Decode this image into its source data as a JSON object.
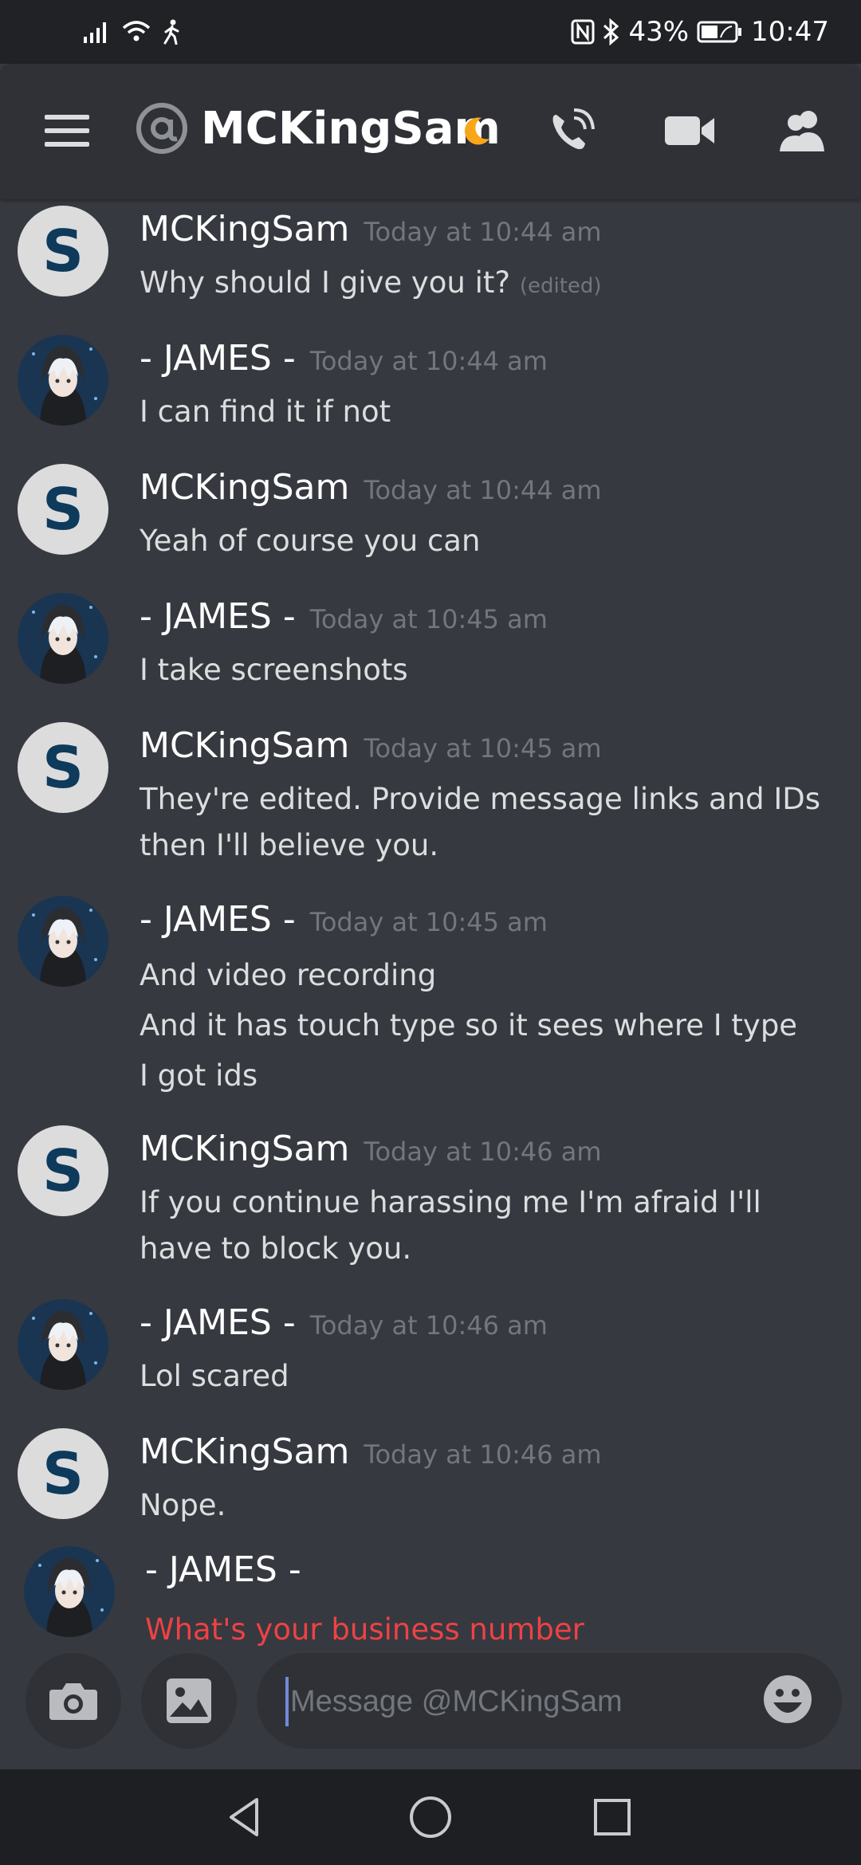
{
  "status_bar": {
    "battery_percent": "43%",
    "time": "10:47",
    "icons": [
      "signal-icon",
      "wifi-icon",
      "walking-icon",
      "nfc-icon",
      "bluetooth-icon",
      "battery-icon"
    ]
  },
  "header": {
    "title": "MCKingSam",
    "buttons": [
      "menu-icon",
      "call-icon",
      "video-icon",
      "members-icon"
    ]
  },
  "messages": [
    {
      "author": "MCKingSam",
      "avatar": "S",
      "time": "Today at 10:44 am",
      "lines": [
        "Why should I give you it?"
      ],
      "edited": "(edited)"
    },
    {
      "author": "- JAMES -",
      "avatar": "image",
      "time": "Today at 10:44 am",
      "lines": [
        "I can find it if not"
      ]
    },
    {
      "author": "MCKingSam",
      "avatar": "S",
      "time": "Today at 10:44 am",
      "lines": [
        "Yeah of course you can"
      ]
    },
    {
      "author": "- JAMES -",
      "avatar": "image",
      "time": "Today at 10:45 am",
      "lines": [
        "I take screenshots"
      ]
    },
    {
      "author": "MCKingSam",
      "avatar": "S",
      "time": "Today at 10:45 am",
      "lines": [
        "They're edited. Provide message links and IDs then I'll believe you."
      ]
    },
    {
      "author": "- JAMES -",
      "avatar": "image",
      "time": "Today at 10:45 am",
      "lines": [
        "And video recording",
        "And it has touch type so it sees where I type",
        "I got ids"
      ]
    },
    {
      "author": "MCKingSam",
      "avatar": "S",
      "time": "Today at 10:46 am",
      "lines": [
        "If you continue harassing me I'm afraid I'll have to block you."
      ]
    },
    {
      "author": "- JAMES -",
      "avatar": "image",
      "time": "Today at 10:46 am",
      "lines": [
        "Lol scared"
      ]
    },
    {
      "author": "MCKingSam",
      "avatar": "S",
      "time": "Today at 10:46 am",
      "lines": [
        "Nope."
      ]
    },
    {
      "author": "- JAMES -",
      "avatar": "image",
      "time": "",
      "lines": [
        "What's your business number"
      ],
      "pending": true
    }
  ],
  "composer": {
    "placeholder": "Message @MCKingSam"
  },
  "colors": {
    "background": "#36393f",
    "header": "#2f3136",
    "pending_text": "#ed4245",
    "timestamp": "#72767d",
    "moon": "#faa61a"
  }
}
